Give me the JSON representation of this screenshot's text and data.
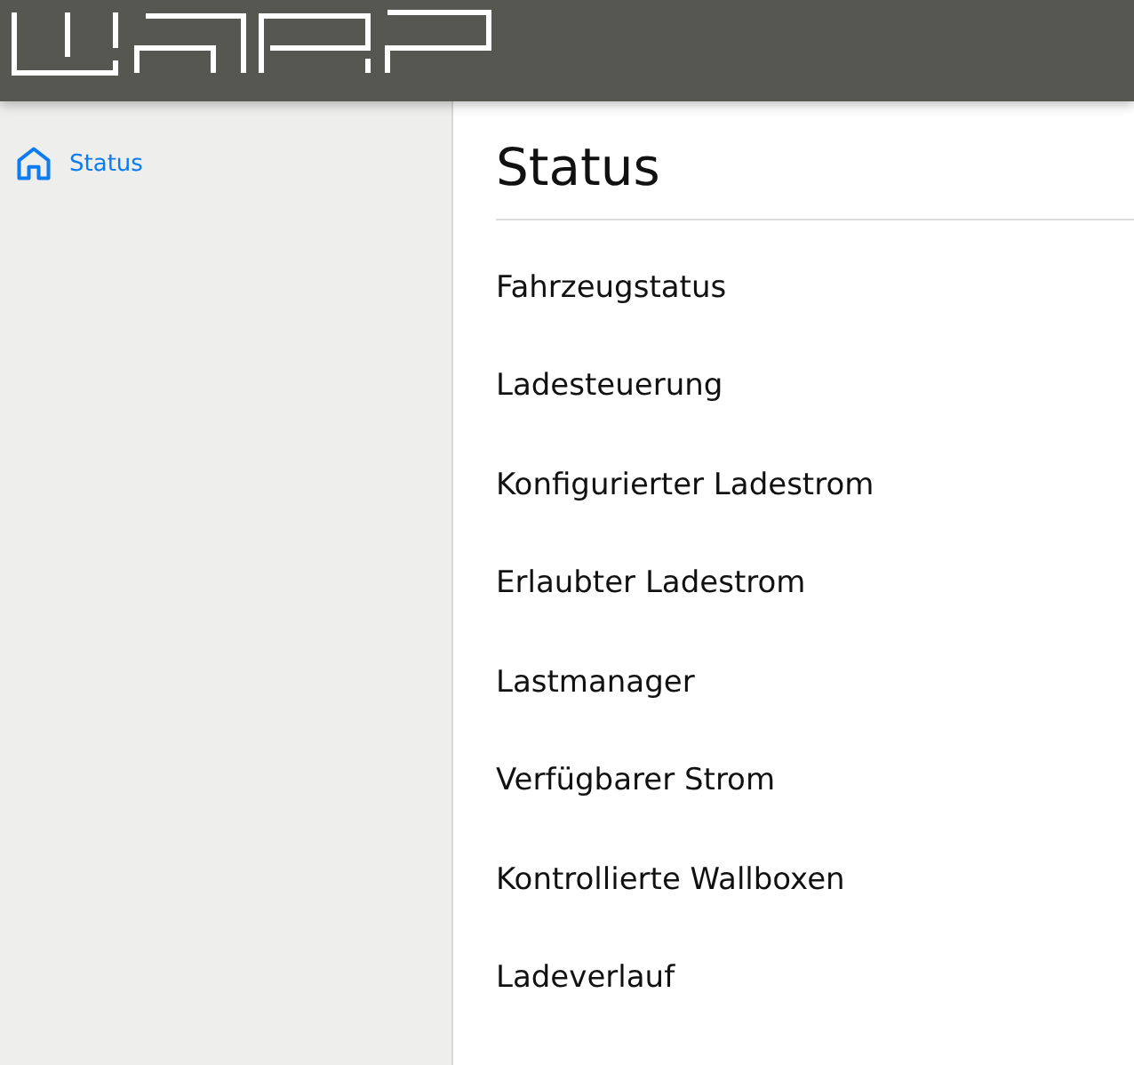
{
  "sidebar": {
    "items": [
      {
        "label": "Status",
        "selected": true
      }
    ]
  },
  "title": "Status",
  "sections": [
    "Fahrzeugstatus",
    "Ladesteuerung",
    "Konfigurierter Ladestrom",
    "Erlaubter Ladestrom",
    "Lastmanager",
    "Verfügbarer Strom",
    "Kontrollierte Wallboxen",
    "Ladeverlauf"
  ]
}
